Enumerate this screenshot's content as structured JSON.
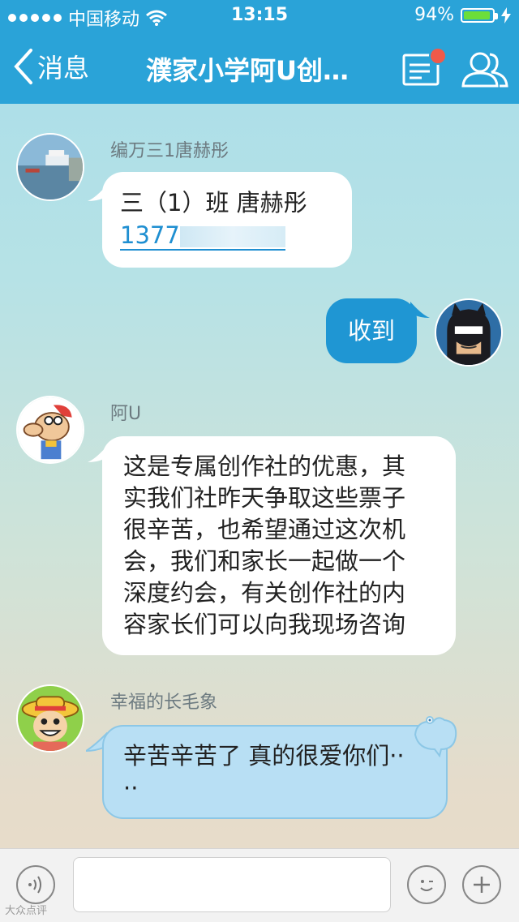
{
  "status_bar": {
    "carrier": "中国移动",
    "time": "13:15",
    "battery": "94%",
    "battery_level": 0.94
  },
  "nav": {
    "back_label": "消息",
    "title": "濮家小学阿U创…"
  },
  "messages": [
    {
      "sender": "编万三1唐赫彤",
      "line1": "三（1）班 唐赫彤",
      "phone": "1377"
    },
    {
      "text": "收到"
    },
    {
      "sender": "阿U",
      "lines": [
        "这是专属创作社的优惠，其",
        "实我们社昨天争取这些票子",
        "很辛苦，也希望通过这次机",
        "会，我们和家长一起做一个",
        "深度约会，有关创作社的内",
        "容家长们可以向我现场咨询"
      ]
    },
    {
      "sender": "幸福的长毛象",
      "lines": [
        "辛苦辛苦了 真的很爱你们··",
        "··"
      ]
    }
  ],
  "input_bar": {
    "placeholder": ""
  },
  "watermark": "大众点评",
  "colors": {
    "accent": "#2aa3d8",
    "my_bubble": "#1f96d3",
    "battery_fill": "#6cde3a",
    "badge": "#f05a4a"
  }
}
